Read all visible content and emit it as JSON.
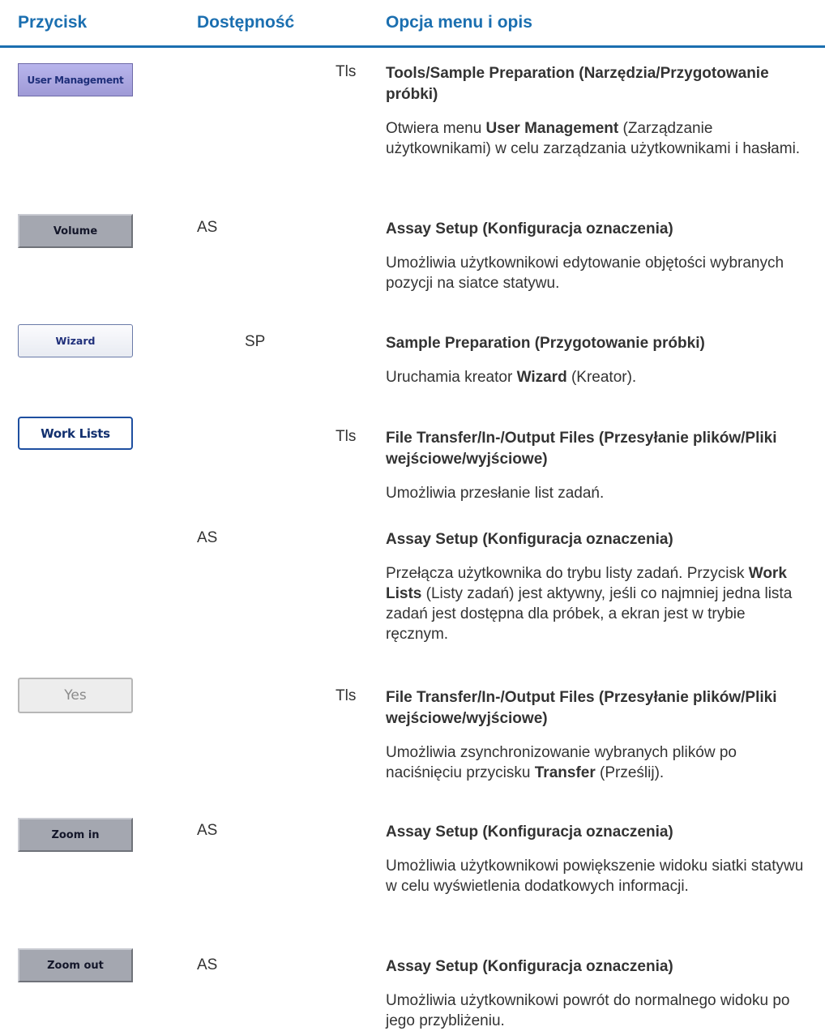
{
  "header": {
    "col1": "Przycisk",
    "col2": "Dostępność",
    "col3": "Opcja menu i opis"
  },
  "rows": {
    "user_management": {
      "button": "User Management",
      "avail": "Tls",
      "title": "Tools/Sample Preparation (Narzędzia/Przygotowanie próbki)",
      "d1": "Otwiera menu ",
      "d2": "User Management",
      "d3": " (Zarządzanie użytkownikami) w celu zarządzania użytkownikami i hasłami."
    },
    "volume": {
      "button": "Volume",
      "avail": "AS",
      "title": "Assay Setup (Konfiguracja oznaczenia)",
      "desc": "Umożliwia użytkownikowi edytowanie objętości wybranych pozycji na siatce statywu."
    },
    "wizard": {
      "button": "Wizard",
      "avail": "SP",
      "title": "Sample Preparation (Przygotowanie próbki)",
      "d1": "Uruchamia kreator ",
      "d2": "Wizard",
      "d3": " (Kreator)."
    },
    "work_lists": {
      "button": "Work Lists",
      "avail": "Tls",
      "title": "File Transfer/In-/Output Files (Przesyłanie plików/Pliki wejściowe/wyjściowe)",
      "desc": "Umożliwia przesłanie list zadań."
    },
    "work_lists_as": {
      "avail": "AS",
      "title": "Assay Setup (Konfiguracja oznaczenia)",
      "d1": "Przełącza użytkownika do trybu listy zadań. Przycisk ",
      "d2": "Work Lists",
      "d3": " (Listy zadań) jest aktywny, jeśli co najmniej jedna lista zadań jest dostępna dla próbek, a ekran jest w trybie ręcznym."
    },
    "yes": {
      "button": "Yes",
      "avail": "Tls",
      "title": "File Transfer/In-/Output Files (Przesyłanie plików/Pliki wejściowe/wyjściowe)",
      "d1": "Umożliwia zsynchronizowanie wybranych plików po naciśnięciu przycisku ",
      "d2": "Transfer",
      "d3": " (Prześlij)."
    },
    "zoom_in": {
      "button": "Zoom in",
      "avail": "AS",
      "title": "Assay Setup (Konfiguracja oznaczenia)",
      "desc": "Umożliwia użytkownikowi powiększenie widoku siatki statywu w celu wyświetlenia dodatkowych informacji."
    },
    "zoom_out": {
      "button": "Zoom out",
      "avail": "AS",
      "title": "Assay Setup (Konfiguracja oznaczenia)",
      "desc": "Umożliwia użytkownikowi powrót do normalnego widoku po jego przybliżeniu."
    }
  }
}
